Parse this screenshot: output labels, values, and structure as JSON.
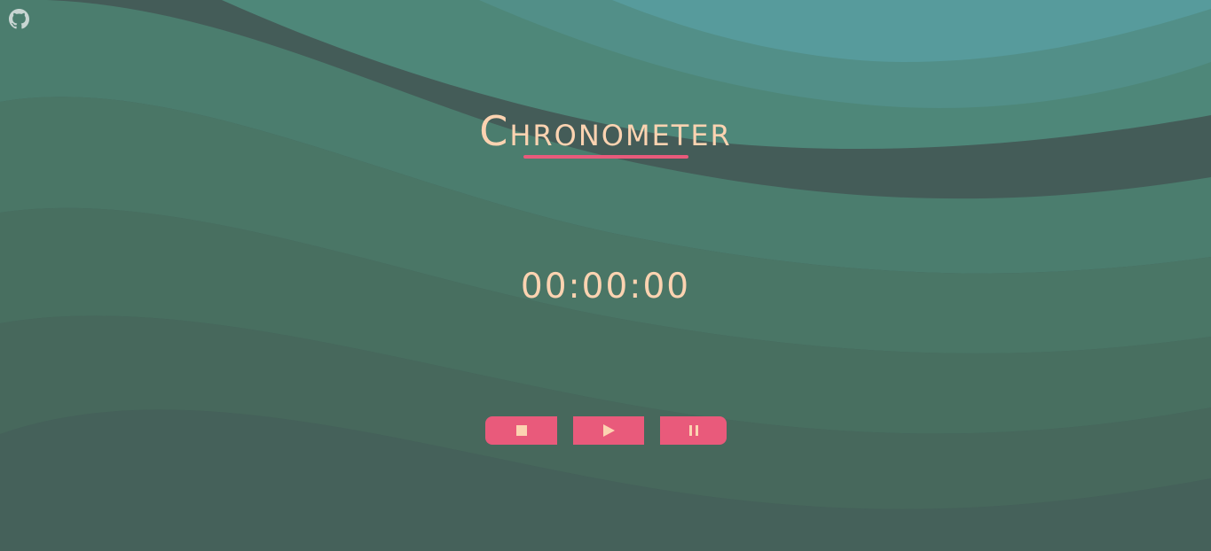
{
  "page": {
    "title": "Chronometer",
    "timer": "00:00:00"
  },
  "icons": {
    "github": "github-icon",
    "stop": "stop-icon",
    "play": "play-icon",
    "pause": "pause-icon"
  },
  "colors": {
    "text": "#fcd3b1",
    "accent": "#e95a7b",
    "bg_dark": "#445c58",
    "bg_light": "#5a9c9f",
    "icon_github": "#c8d5d2"
  }
}
